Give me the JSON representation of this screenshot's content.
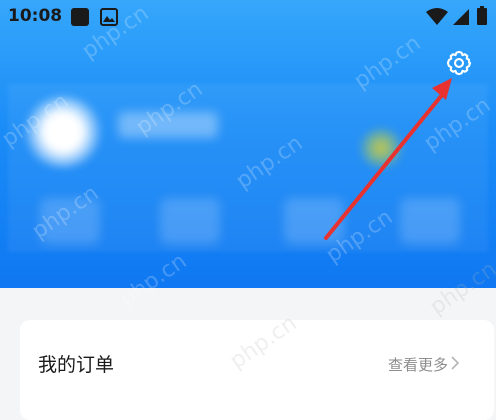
{
  "status_bar": {
    "time": "10:08",
    "icons": [
      "notification-square-icon",
      "image-icon",
      "wifi-icon",
      "signal-icon",
      "battery-icon"
    ]
  },
  "header": {
    "settings_icon": "gear-icon",
    "accent_color": "#1a8cf7"
  },
  "orders_card": {
    "title": "我的订单",
    "more_label": "查看更多"
  },
  "watermark": "php.cn"
}
